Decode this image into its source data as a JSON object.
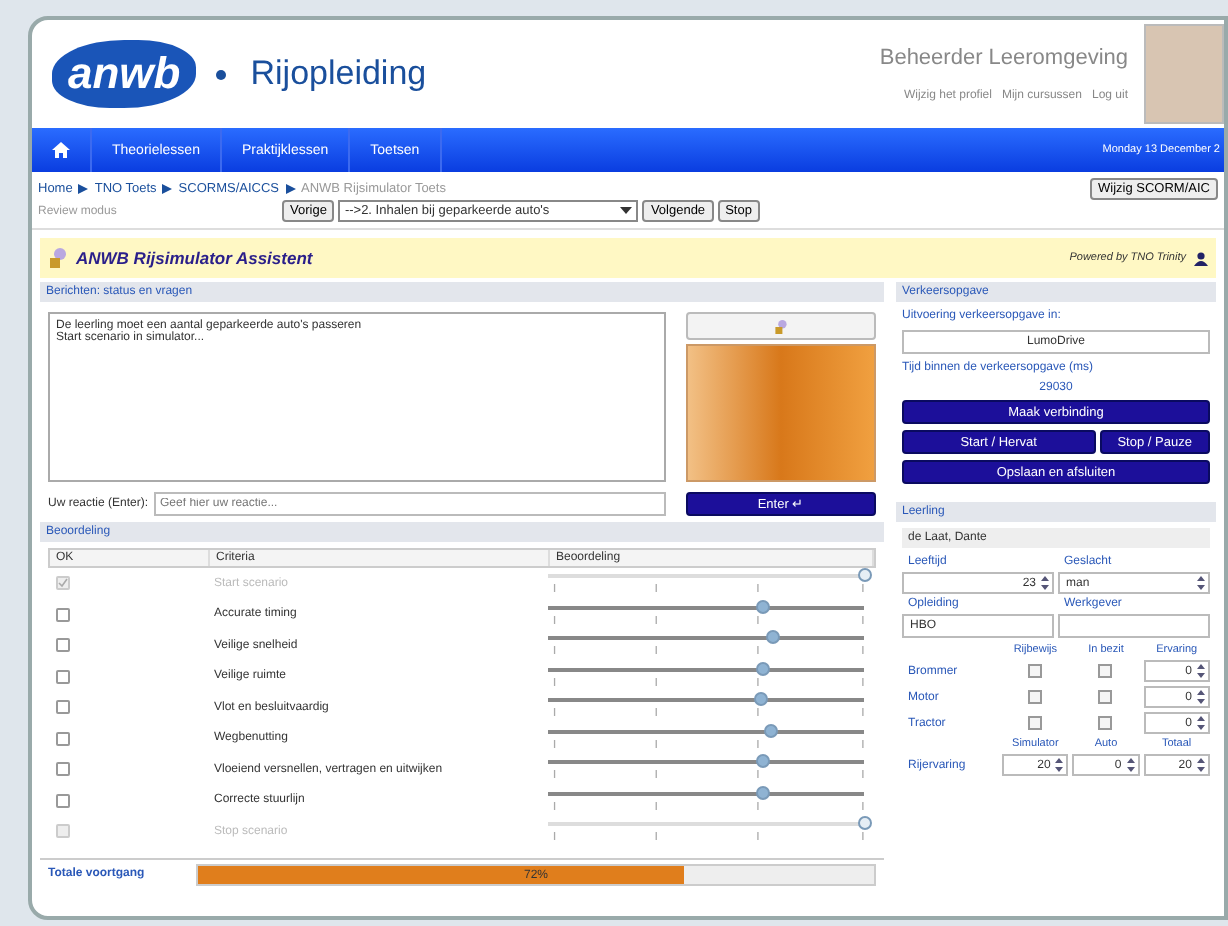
{
  "header": {
    "logo": "anwb",
    "title": "Rijopleiding",
    "user_name": "Beheerder Leeromgeving",
    "links": [
      "Wijzig het profiel",
      "Mijn cursussen",
      "Log uit"
    ]
  },
  "nav": {
    "items": [
      "Theorielessen",
      "Praktijklessen",
      "Toetsen"
    ],
    "date": "Monday 13 December 2"
  },
  "breadcrumb": {
    "items": [
      "Home",
      "TNO Toets",
      "SCORMS/AICCS",
      "ANWB Rijsimulator Toets"
    ],
    "button": "Wijzig SCORM/AIC"
  },
  "review": {
    "mode": "Review modus",
    "prev": "Vorige",
    "select": "-->2. Inhalen bij geparkeerde auto's",
    "next": "Volgende",
    "stop": "Stop"
  },
  "assistant": {
    "title": "ANWB Rijsimulator Assistent",
    "powered": "Powered by TNO Trinity"
  },
  "messages": {
    "title": "Berichten: status en vragen",
    "lines": [
      "De leerling moet een aantal geparkeerde auto's passeren",
      "Start scenario in simulator..."
    ],
    "response_label": "Uw reactie (Enter):",
    "placeholder": "Geef hier uw reactie...",
    "enter": "Enter ↵"
  },
  "assessment": {
    "title": "Beoordeling",
    "columns": [
      "OK",
      "Criteria",
      "Beoordeling"
    ],
    "rows": [
      {
        "criterion": "Start scenario",
        "checked": true,
        "disabled": true,
        "level": 1.0
      },
      {
        "criterion": "Accurate timing",
        "checked": false,
        "disabled": false,
        "level": 0.68
      },
      {
        "criterion": "Veilige snelheid",
        "checked": false,
        "disabled": false,
        "level": 0.71
      },
      {
        "criterion": "Veilige ruimte",
        "checked": false,
        "disabled": false,
        "level": 0.68
      },
      {
        "criterion": "Vlot en besluitvaardig",
        "checked": false,
        "disabled": false,
        "level": 0.67
      },
      {
        "criterion": "Wegbenutting",
        "checked": false,
        "disabled": false,
        "level": 0.7
      },
      {
        "criterion": "Vloeiend versnellen, vertragen en uitwijken",
        "checked": false,
        "disabled": false,
        "level": 0.68
      },
      {
        "criterion": "Correcte stuurlijn",
        "checked": false,
        "disabled": false,
        "level": 0.68
      },
      {
        "criterion": "Stop scenario",
        "checked": false,
        "disabled": true,
        "level": 1.0
      }
    ],
    "total": {
      "label": "Totale voortgang",
      "level": 0.72,
      "text": "72%"
    }
  },
  "traffic": {
    "title": "Verkeersopgave",
    "run_label": "Uitvoering verkeersopgave in:",
    "run_value": "LumoDrive",
    "time_label": "Tijd binnen de verkeersopgave (ms)",
    "time_value": "29030",
    "connect": "Maak verbinding",
    "start": "Start / Hervat",
    "stop": "Stop / Pauze",
    "save": "Opslaan en afsluiten"
  },
  "student": {
    "title": "Leerling",
    "name": "de Laat, Dante",
    "age_label": "Leeftijd",
    "age": "23",
    "gender_label": "Geslacht",
    "gender": "man",
    "education_label": "Opleiding",
    "education": "HBO",
    "employer_label": "Werkgever",
    "license_columns": [
      "Rijbewijs",
      "In bezit",
      "Ervaring"
    ],
    "licenses": [
      {
        "name": "Brommer",
        "license": false,
        "owned": false,
        "experience": "0"
      },
      {
        "name": "Motor",
        "license": false,
        "owned": false,
        "experience": "0"
      },
      {
        "name": "Tractor",
        "license": false,
        "owned": false,
        "experience": "0"
      }
    ],
    "experience_columns": [
      "Simulator",
      "Auto",
      "Totaal"
    ],
    "experience_label": "Rijervaring",
    "experience": [
      "20",
      "0",
      "20"
    ]
  }
}
